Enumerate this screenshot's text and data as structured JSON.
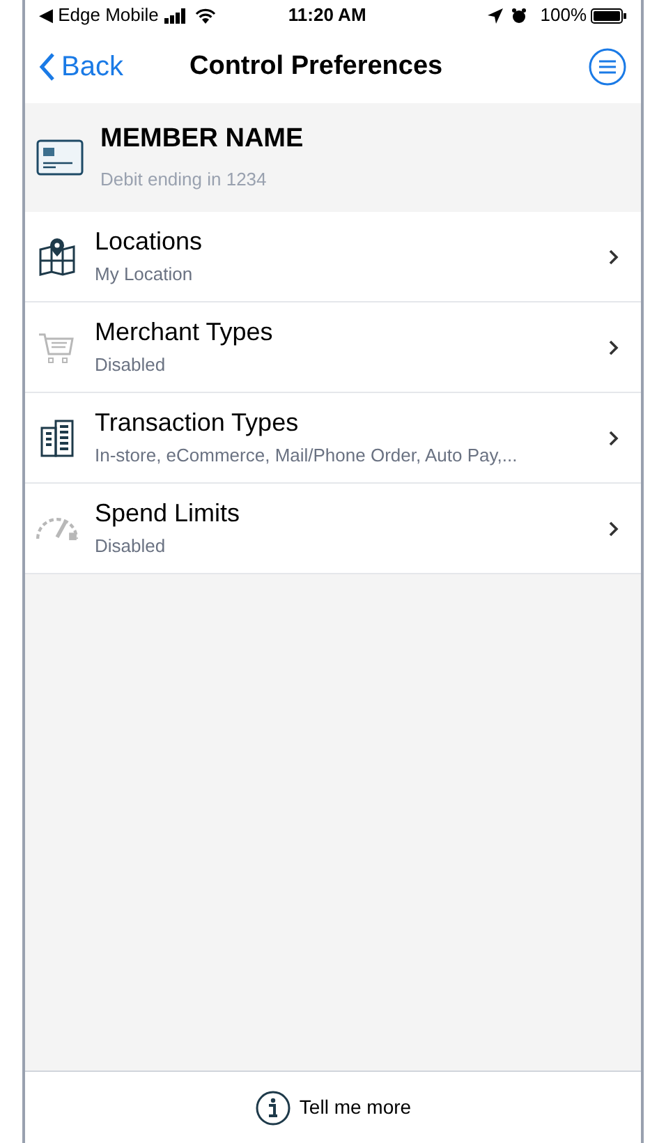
{
  "status_bar": {
    "carrier": "◀ Edge Mobile",
    "time": "11:20 AM",
    "battery": "100%"
  },
  "nav": {
    "back": "Back",
    "title": "Control Preferences"
  },
  "member": {
    "name": "MEMBER NAME",
    "detail": "Debit ending in 1234"
  },
  "rows": [
    {
      "kind": "map",
      "title": "Locations",
      "subtitle": "My Location",
      "disabled": false
    },
    {
      "kind": "cart",
      "title": "Merchant Types",
      "subtitle": "Disabled",
      "disabled": true
    },
    {
      "kind": "building",
      "title": "Transaction Types",
      "subtitle": "In-store, eCommerce, Mail/Phone Order, Auto Pay,...",
      "disabled": false
    },
    {
      "kind": "gauge",
      "title": "Spend Limits",
      "subtitle": "Disabled",
      "disabled": true
    }
  ],
  "footer": {
    "link": "Tell me more"
  }
}
